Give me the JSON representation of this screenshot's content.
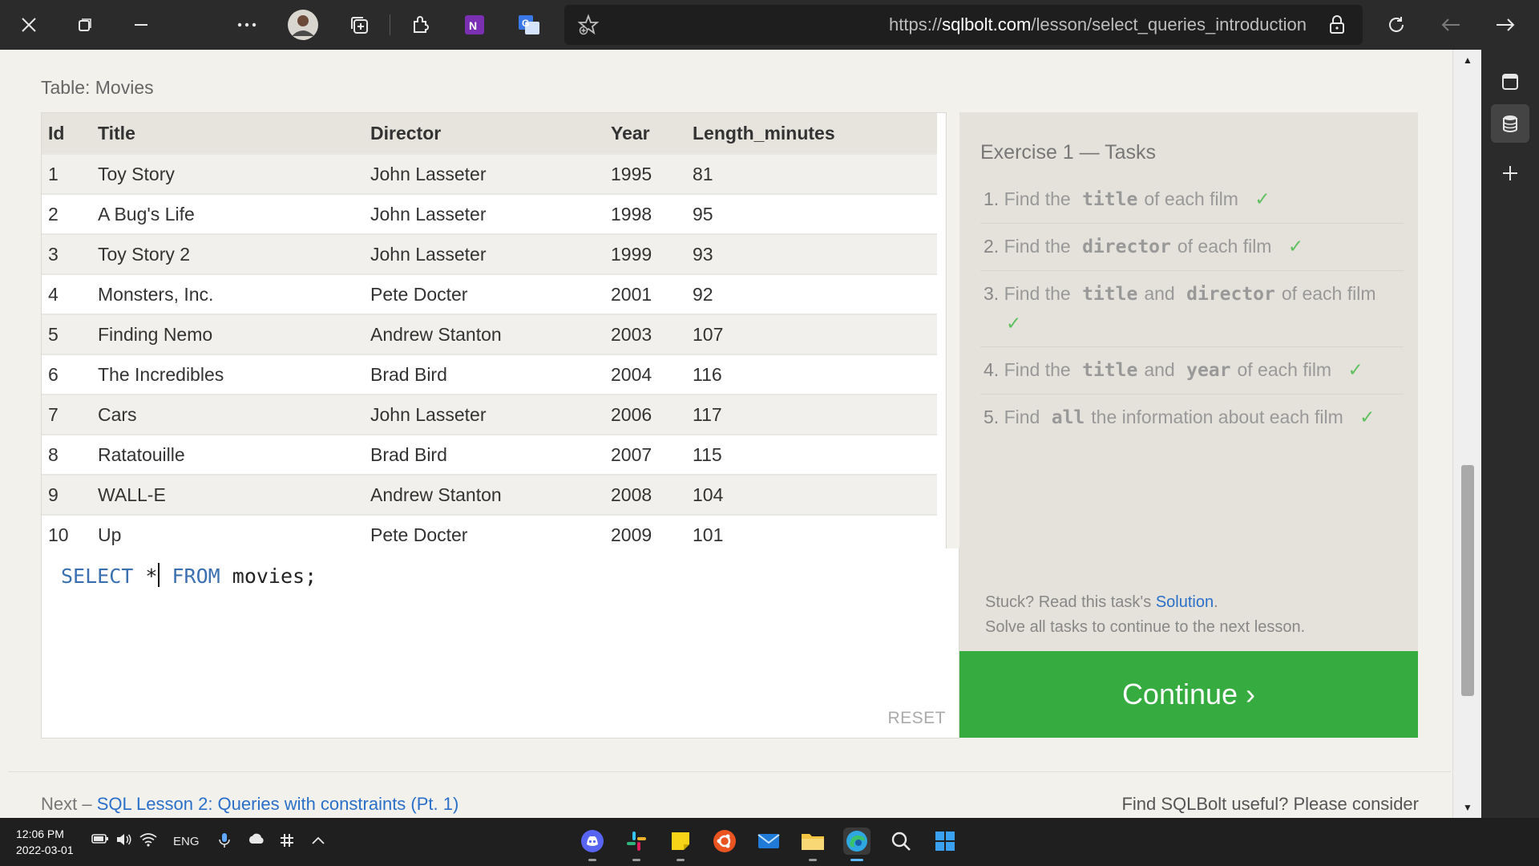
{
  "browser": {
    "url_prefix": "https://",
    "url_domain": "sqlbolt.com",
    "url_path": "/lesson/select_queries_introduction",
    "icons": [
      "close-icon",
      "restore-icon",
      "minimize-icon",
      "more-icon",
      "profile-avatar",
      "collections-icon",
      "extensions-icon",
      "onenote-icon",
      "translate-icon",
      "favorite-add-icon",
      "lock-icon",
      "refresh-icon",
      "back-icon",
      "forward-icon"
    ]
  },
  "sidebar": {
    "icons": [
      "tab-panel-icon",
      "database-icon",
      "add-icon"
    ]
  },
  "table": {
    "caption": "Table: Movies",
    "columns": [
      "Id",
      "Title",
      "Director",
      "Year",
      "Length_minutes"
    ],
    "rows": [
      [
        "1",
        "Toy Story",
        "John Lasseter",
        "1995",
        "81"
      ],
      [
        "2",
        "A Bug's Life",
        "John Lasseter",
        "1998",
        "95"
      ],
      [
        "3",
        "Toy Story 2",
        "John Lasseter",
        "1999",
        "93"
      ],
      [
        "4",
        "Monsters, Inc.",
        "Pete Docter",
        "2001",
        "92"
      ],
      [
        "5",
        "Finding Nemo",
        "Andrew Stanton",
        "2003",
        "107"
      ],
      [
        "6",
        "The Incredibles",
        "Brad Bird",
        "2004",
        "116"
      ],
      [
        "7",
        "Cars",
        "John Lasseter",
        "2006",
        "117"
      ],
      [
        "8",
        "Ratatouille",
        "Brad Bird",
        "2007",
        "115"
      ],
      [
        "9",
        "WALL-E",
        "Andrew Stanton",
        "2008",
        "104"
      ],
      [
        "10",
        "Up",
        "Pete Docter",
        "2009",
        "101"
      ]
    ]
  },
  "editor": {
    "kw_select": "SELECT",
    "star": "*",
    "kw_from": "FROM",
    "rest": "movies;",
    "reset_label": "RESET"
  },
  "exercise": {
    "title": "Exercise 1 — Tasks",
    "tasks": [
      {
        "num": "1.",
        "parts": [
          "Find the",
          "title",
          "of each film"
        ]
      },
      {
        "num": "2.",
        "parts": [
          "Find the",
          "director",
          "of each film"
        ]
      },
      {
        "num": "3.",
        "parts": [
          "Find the",
          "title",
          "and",
          "director",
          "of each film"
        ]
      },
      {
        "num": "4.",
        "parts": [
          "Find the",
          "title",
          "and",
          "year",
          "of each film"
        ]
      },
      {
        "num": "5.",
        "parts": [
          "Find",
          "all",
          "the information about each film"
        ]
      }
    ],
    "check": "✓",
    "stuck_prefix": "Stuck? Read this task's",
    "solution_link": "Solution",
    "stuck_suffix": ".",
    "solve_all": "Solve all tasks to continue to the next lesson.",
    "continue_label": "Continue ›"
  },
  "footer": {
    "next_prefix": "Next –",
    "next_link": "SQL Lesson 2: Queries with constraints (Pt. 1)",
    "useful": "Find SQLBolt useful? Please consider"
  },
  "taskbar": {
    "time": "12:06 PM",
    "date": "2022-03-01",
    "lang": "ENG"
  },
  "colors": {
    "continue_bg": "#35ab40",
    "link": "#2a70c8",
    "sql_keyword": "#3a6fb0"
  }
}
